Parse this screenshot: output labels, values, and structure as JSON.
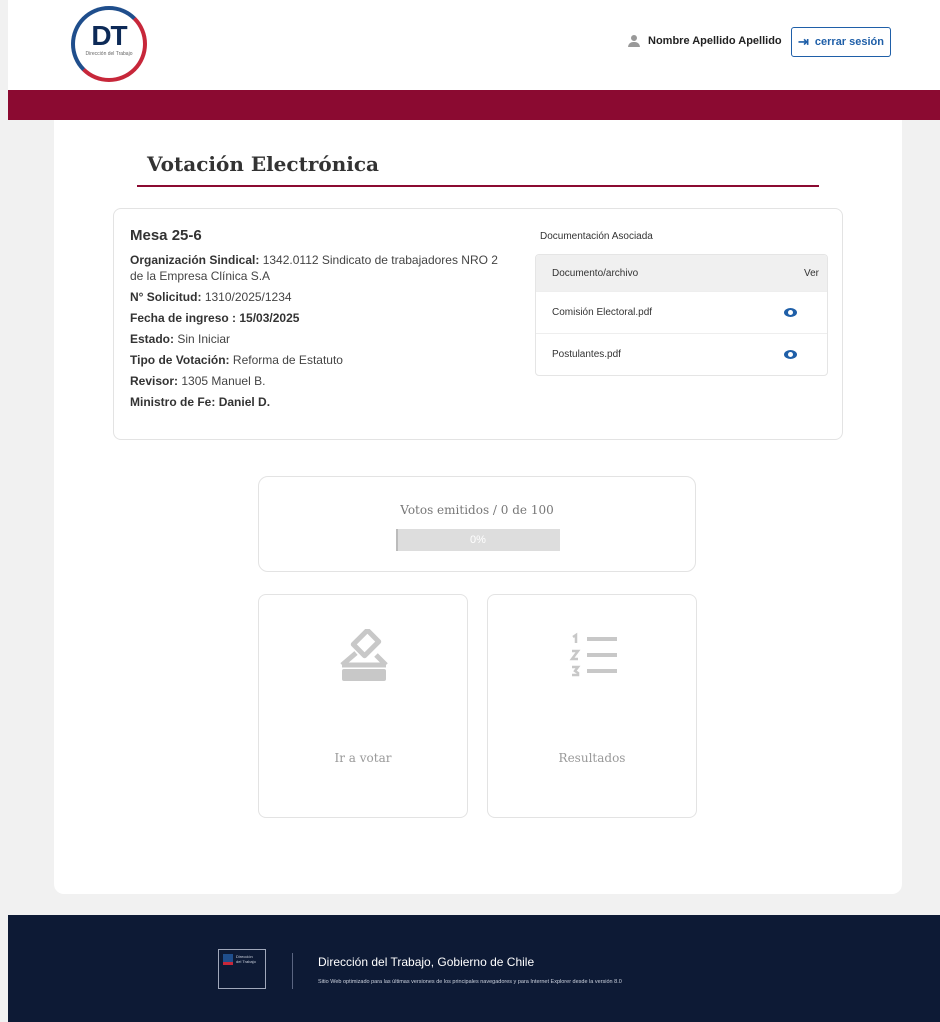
{
  "header": {
    "logo_text": "DT",
    "logo_subtext": "Dirección del Trabajo",
    "user_name": "Nombre Apellido Apellido",
    "logout_label": "cerrar sesión"
  },
  "page": {
    "title": "Votación Electrónica"
  },
  "mesa": {
    "title": "Mesa 25-6",
    "fields": [
      {
        "label": "Organización Sindical:",
        "value": "1342.0112 Sindicato de trabajadores NRO 2 de la Empresa Clínica S.A"
      },
      {
        "label": "N° Solicitud:",
        "value": "1310/2025/1234"
      },
      {
        "label": "Fecha de ingreso :",
        "value": "15/03/2025"
      },
      {
        "label": "Estado:",
        "value": "Sin Iniciar"
      },
      {
        "label": "Tipo de Votación:",
        "value": "Reforma de Estatuto"
      },
      {
        "label": "Revisor:",
        "value": "1305 Manuel B."
      },
      {
        "label": "Ministro de Fe:",
        "value": " Daniel D."
      }
    ]
  },
  "documents": {
    "title": "Documentación Asociada",
    "col_document": "Documento/archivo",
    "col_view": "Ver",
    "rows": [
      {
        "name": "Comisión Electoral.pdf"
      },
      {
        "name": "Postulantes.pdf"
      }
    ]
  },
  "votes": {
    "label": "Votos emitidos / 0 de 100",
    "progress_label": "0%",
    "progress_fraction": 0.0
  },
  "actions": {
    "vote_label": "Ir a votar",
    "results_label": "Resultados",
    "vote_icon": "ballot-box-icon",
    "results_icon": "numbered-list-icon"
  },
  "footer": {
    "logo_line1": "Dirección",
    "logo_line2": "del Trabajo",
    "title": "Dirección del Trabajo, Gobierno de Chile",
    "note": "Sitio Web optimizado para las últimas versiones de los principales navegadores y para Internet Explorer desde la versión 8.0"
  },
  "colors": {
    "brand_band": "#8b0a31",
    "link_blue": "#1f5fa8",
    "footer_bg": "#0d1a35"
  }
}
